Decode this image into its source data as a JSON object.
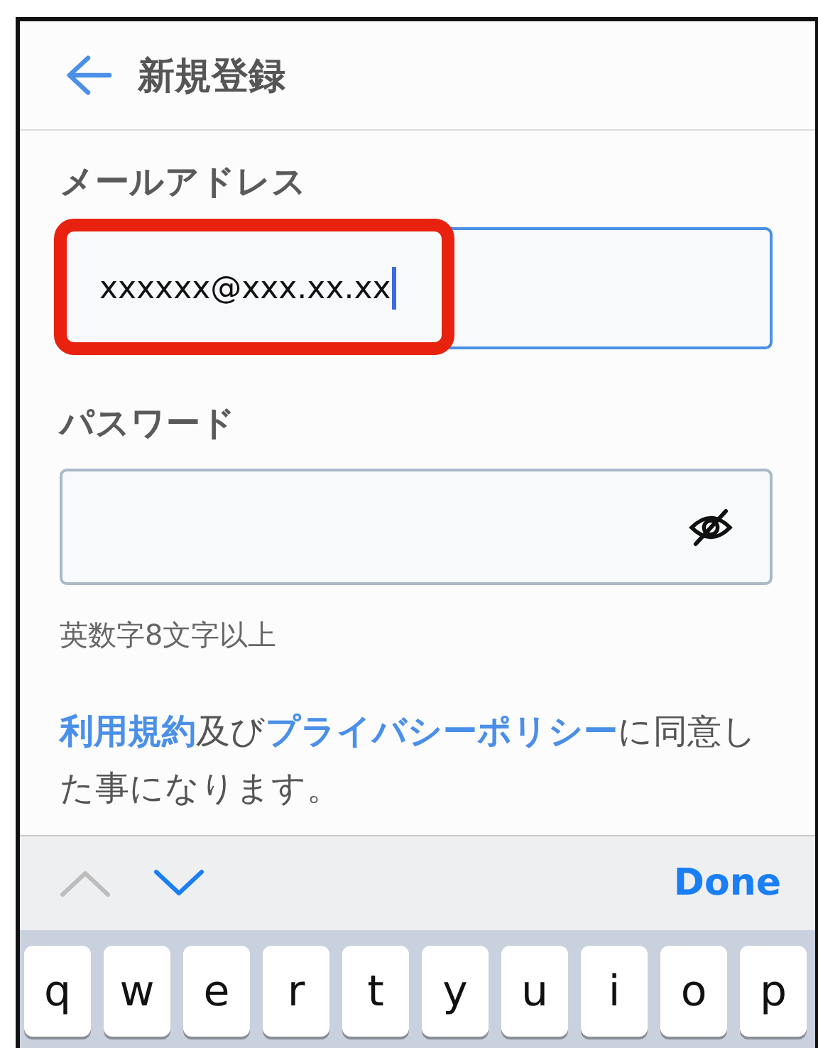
{
  "header": {
    "title": "新規登録"
  },
  "email": {
    "label": "メールアドレス",
    "value": "xxxxxx@xxx.xx.xx",
    "focused": true,
    "highlighted": true
  },
  "password": {
    "label": "パスワード",
    "hint": "英数字8文字以上",
    "visible": false
  },
  "terms": [
    {
      "text": "利用規約",
      "kind": "link"
    },
    {
      "text": "及び",
      "kind": "plain"
    },
    {
      "text": "プライバシーポリシー",
      "kind": "link"
    },
    {
      "text": "に同意した事になります。",
      "kind": "plain"
    }
  ],
  "toolbar": {
    "previous": {
      "disabled": true
    },
    "next": {
      "disabled": false
    },
    "done": "Done"
  },
  "keyboard": {
    "keys": [
      "q",
      "w",
      "e",
      "r",
      "t",
      "y",
      "u",
      "i",
      "o",
      "p"
    ]
  }
}
